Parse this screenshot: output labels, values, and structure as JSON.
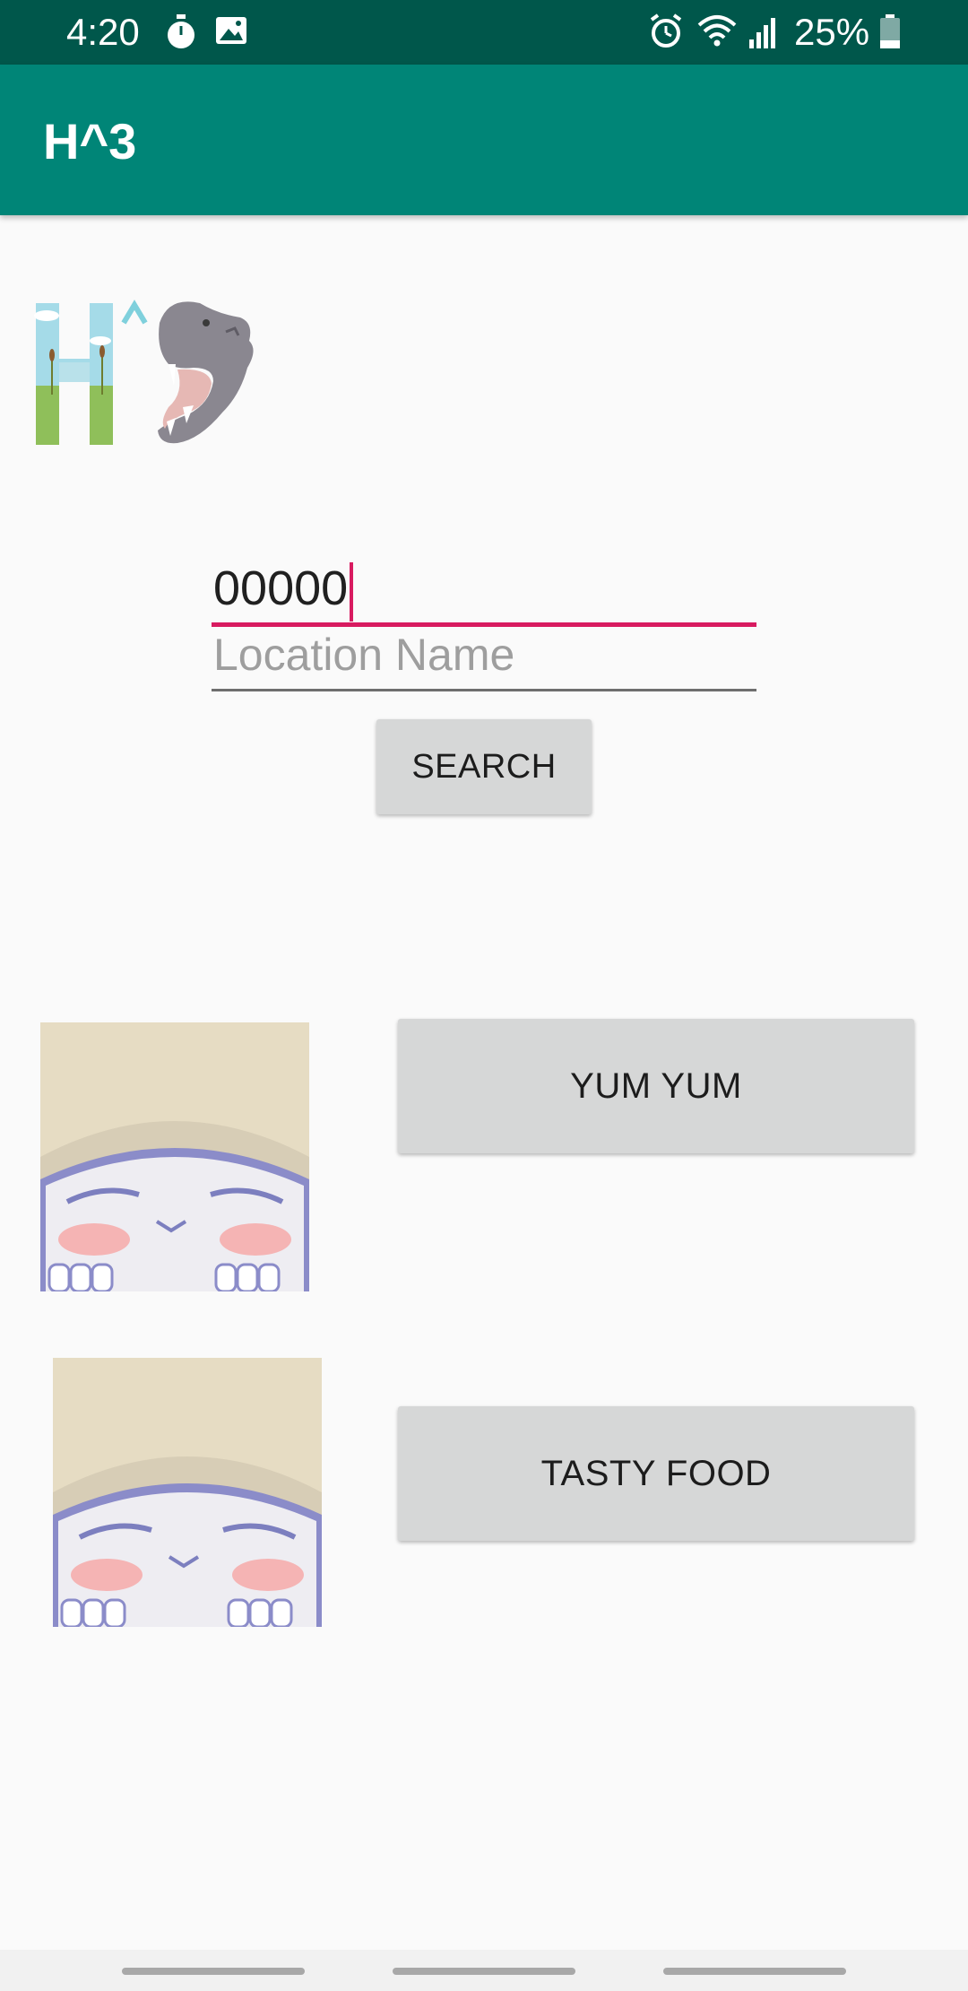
{
  "status_bar": {
    "time": "4:20",
    "battery": "25%",
    "icons": [
      "stopwatch-icon",
      "image-icon",
      "alarm-icon",
      "wifi-icon",
      "signal-icon",
      "battery-icon"
    ]
  },
  "app_bar": {
    "title": "H^3"
  },
  "logo": {
    "name": "hippo-logo"
  },
  "form": {
    "zip_value": "00000",
    "location_placeholder": "Location Name",
    "search_label": "SEARCH"
  },
  "results": [
    {
      "label": "YUM YUM"
    },
    {
      "label": "TASTY FOOD"
    }
  ],
  "colors": {
    "status_bar": "#00574b",
    "app_bar": "#008577",
    "accent": "#d81b60",
    "button": "#d6d7d7",
    "background": "#fafafa"
  }
}
